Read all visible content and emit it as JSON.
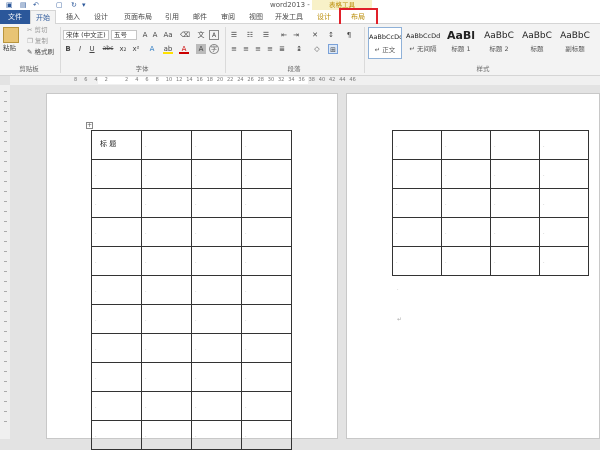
{
  "window": {
    "title": "word2013 - Word",
    "context_group": "表格工具"
  },
  "tabs": [
    "文件",
    "开始",
    "插入",
    "设计",
    "页面布局",
    "引用",
    "邮件",
    "审阅",
    "视图",
    "开发工具",
    "设计",
    "布局"
  ],
  "ribbon": {
    "clipboard": {
      "label": "剪贴板",
      "paste": "粘贴",
      "cut": "剪切",
      "copy": "复制",
      "format_painter": "格式刷"
    },
    "font": {
      "label": "字体",
      "font_name": "宋体 (中文正)",
      "font_size": "五号",
      "bold": "B",
      "italic": "I",
      "underline": "U",
      "strike": "abc",
      "sub": "x₂",
      "sup": "x²"
    },
    "paragraph": {
      "label": "段落"
    },
    "styles": {
      "label": "样式",
      "items": [
        {
          "preview": "AaBbCcDd",
          "name": "↵ 正文"
        },
        {
          "preview": "AaBbCcDd",
          "name": "↵ 无间隔"
        },
        {
          "preview": "AaBl",
          "name": "标题 1"
        },
        {
          "preview": "AaBbC",
          "name": "标题 2"
        },
        {
          "preview": "AaBbC",
          "name": "标题"
        },
        {
          "preview": "AaBbC",
          "name": "副标题"
        }
      ]
    }
  },
  "ruler": {
    "ticks": [
      "8",
      "6",
      "4",
      "2",
      "",
      "2",
      "4",
      "6",
      "8",
      "10",
      "12",
      "14",
      "16",
      "18",
      "20",
      "22",
      "24",
      "26",
      "28",
      "30",
      "32",
      "34",
      "36",
      "38",
      "40",
      "42",
      "44",
      "46"
    ]
  },
  "document": {
    "cell_title": "标 题"
  },
  "colors": {
    "file_tab": "#2b579a",
    "highlight": "#e0202a",
    "context": "#b88a00"
  }
}
